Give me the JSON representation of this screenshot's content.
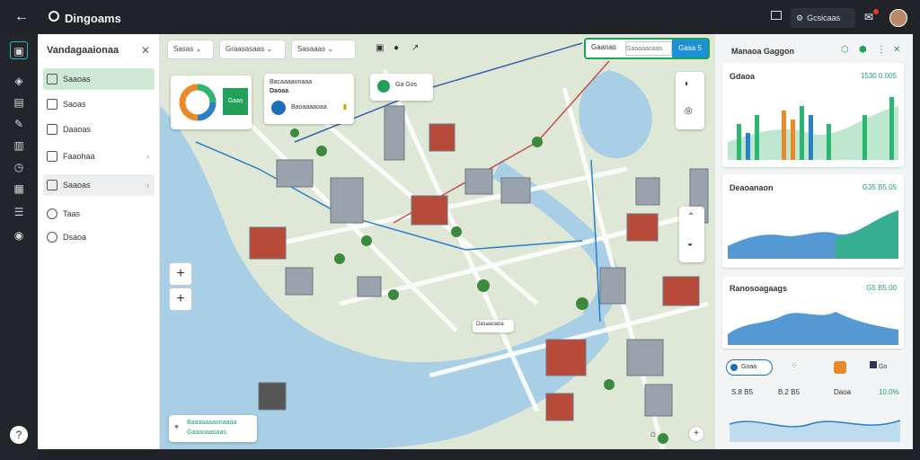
{
  "app": {
    "title": "Dingoams",
    "tb_button": "Gcsicaas"
  },
  "sidebar": {
    "title": "Vandagaaionaa",
    "items": [
      {
        "label": "Saaoas",
        "active": true
      },
      {
        "label": "Saoas"
      },
      {
        "label": "Daaoas"
      },
      {
        "label": "Faaohaa",
        "chevron": true
      },
      {
        "label": "Saaoas",
        "chevron": true,
        "hover": true
      },
      {
        "label": "Taas"
      },
      {
        "label": "Dsaoa"
      }
    ]
  },
  "map_toolbar": {
    "filter1": "Sasas",
    "filter2": "Graasasaas",
    "filter3": "Sasaaas",
    "search_label": "Gaanas",
    "search_placeholder": "Gaaaaaoaas",
    "go_button": "Gasa 5"
  },
  "map_cards": {
    "chart_card_value": "Gaas",
    "info_card": {
      "title": "Bacaaaaonaaa",
      "subtitle": "Daoaa",
      "detail": "Baoaaaaoaa"
    },
    "badge_card": "Ga Gos",
    "map_label": "Dasaaoaoa",
    "footer_text1": "Baaaaaaaonaaaa",
    "footer_text2": "Gaaaoaaoaas"
  },
  "right_panel": {
    "title": "Manaoa Gaggon",
    "cards": [
      {
        "label": "Gdaoa",
        "value": "1530 0.005"
      },
      {
        "label": "Deaoanaon",
        "value": "G35 B5.05"
      },
      {
        "label": "Ranosoagaags",
        "value": "G5 B5.00"
      }
    ],
    "chips": [
      "Goaa",
      "Go",
      "Go",
      "Go"
    ],
    "stats": [
      "S.8 B5",
      "B.2 B5",
      "Daoa",
      "10.0%"
    ]
  },
  "colors": {
    "accent": "#22a05a",
    "water": "#a8cfe6",
    "land": "#dfe8d6",
    "bar_blue": "#2a7fc9",
    "bar_green": "#2bb673",
    "bar_orange": "#e98a2a"
  }
}
